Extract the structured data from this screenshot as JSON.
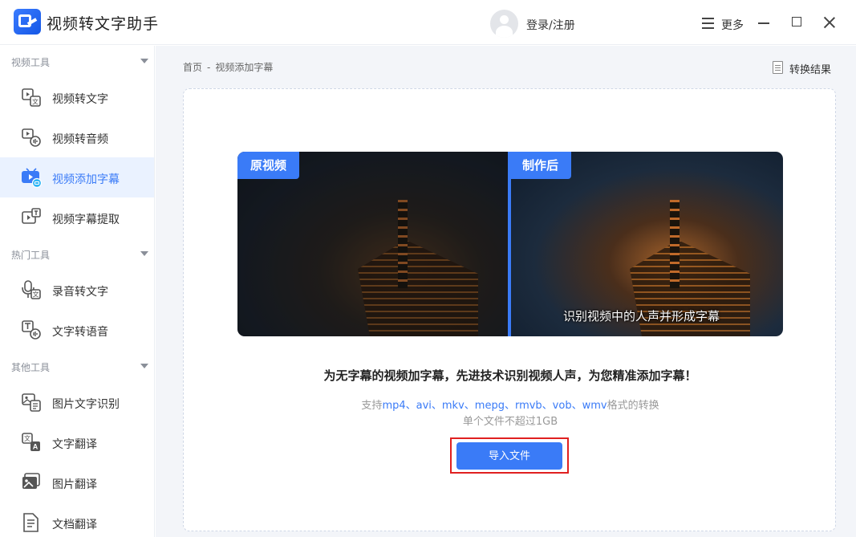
{
  "app": {
    "title": "视频转文字助手",
    "login": "登录/注册",
    "more": "更多"
  },
  "sidebar": {
    "sections": [
      {
        "title": "视频工具",
        "items": [
          "视频转文字",
          "视频转音频",
          "视频添加字幕",
          "视频字幕提取"
        ]
      },
      {
        "title": "热门工具",
        "items": [
          "录音转文字",
          "文字转语音"
        ]
      },
      {
        "title": "其他工具",
        "items": [
          "图片文字识别",
          "文字翻译",
          "图片翻译",
          "文档翻译"
        ]
      }
    ],
    "active_item": "视频添加字幕"
  },
  "breadcrumb": {
    "home": "首页",
    "separator": "-",
    "current": "视频添加字幕"
  },
  "results_label": "转换结果",
  "preview": {
    "before_label": "原视频",
    "after_label": "制作后",
    "subtitle_text": "识别视频中的人声并形成字幕"
  },
  "headline": "为无字幕的视频加字幕，先进技术识别视频人声，为您精准添加字幕！",
  "support": {
    "prefix": "支持",
    "formats": "mp4、avi、mkv、mepg、rmvb、vob、wmv",
    "suffix": "格式的转换"
  },
  "limit": "单个文件不超过1GB",
  "import_button": "导入文件",
  "colors": {
    "accent": "#3a7bf7",
    "active_bg": "#eaf2ff",
    "highlight": "#e02020"
  }
}
